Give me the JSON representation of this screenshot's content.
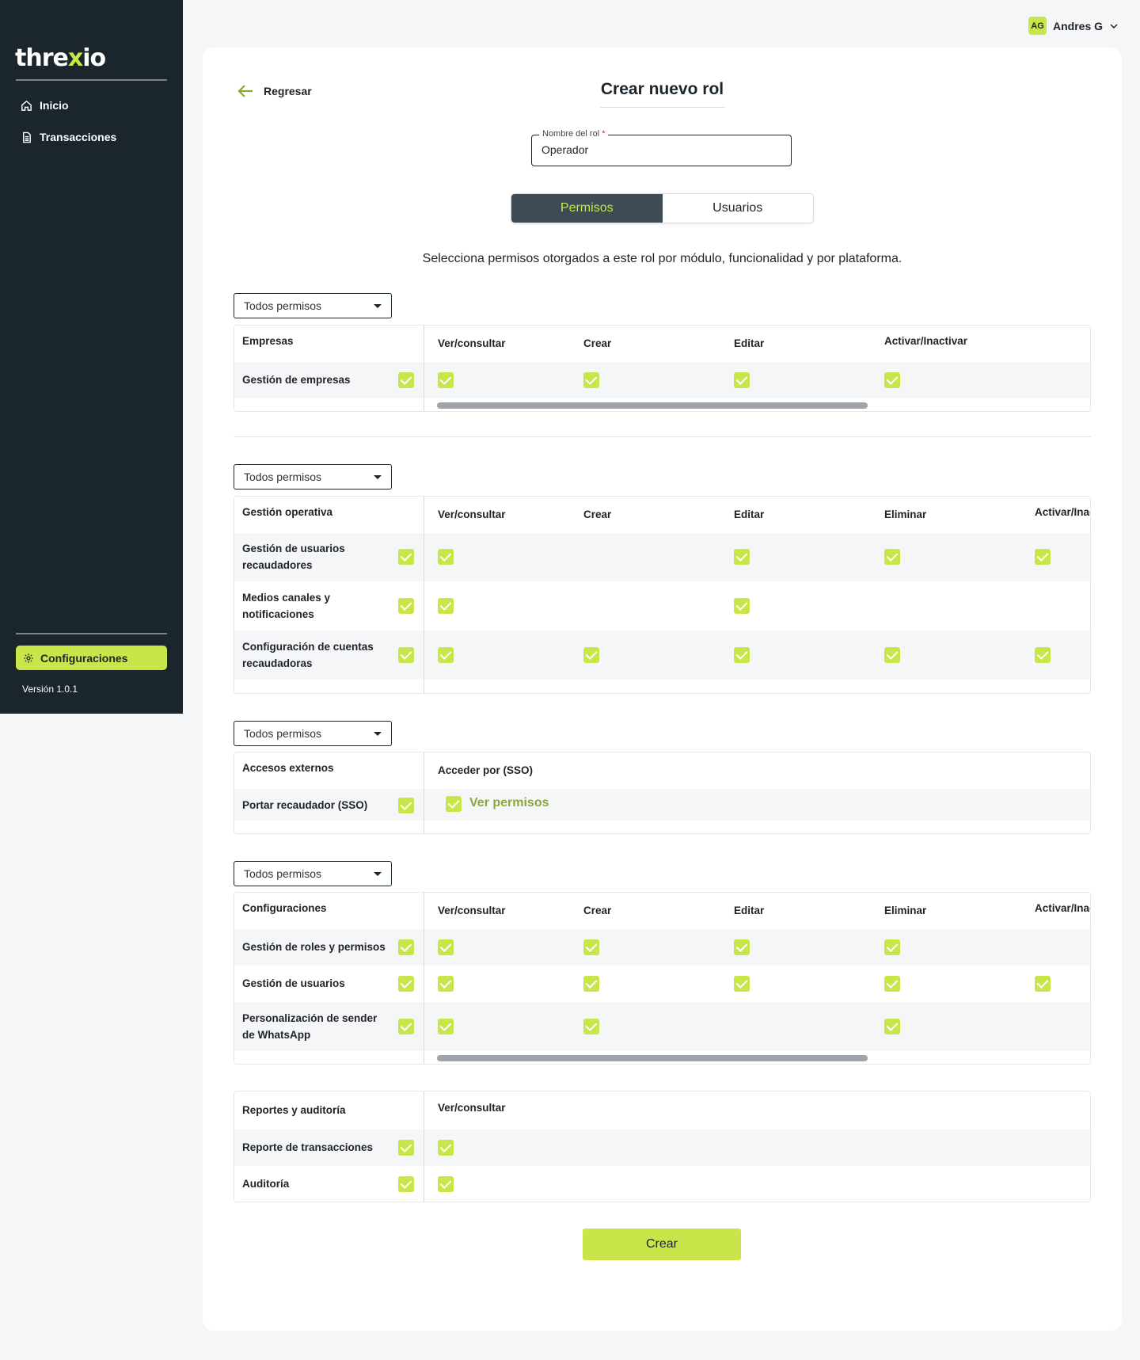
{
  "sidebar": {
    "logo_pre": "thre",
    "logo_x": "x",
    "logo_post": "io",
    "items": [
      {
        "label": "Inicio",
        "icon": "home-icon"
      },
      {
        "label": "Transacciones",
        "icon": "document-icon"
      }
    ],
    "config_label": "Configuraciones",
    "version": "Versión 1.0.1"
  },
  "user": {
    "initials": "AG",
    "name": "Andres G"
  },
  "page": {
    "back_label": "Regresar",
    "title": "Crear nuevo rol",
    "role_field": {
      "label": "Nombre del rol",
      "required_mark": "*",
      "value": "Operador"
    },
    "tabs": {
      "permisos": "Permisos",
      "usuarios": "Usuarios"
    },
    "description": "Selecciona permisos otorgados a este rol por módulo, funcionalidad y por plataforma.",
    "create_label": "Crear"
  },
  "sections": {
    "empresas": {
      "dropdown": "Todos permisos",
      "header": "Empresas",
      "columns": [
        "Ver/consultar",
        "Crear",
        "Editar",
        "Activar/Inactivar"
      ],
      "rows": [
        {
          "label": "Gestión de empresas"
        }
      ]
    },
    "operativa": {
      "dropdown": "Todos permisos",
      "header": "Gestión operativa",
      "columns": [
        "Ver/consultar",
        "Crear",
        "Editar",
        "Eliminar",
        "Activar/Inac"
      ],
      "rows": [
        {
          "label_1": "Gestión de usuarios",
          "label_2": "recaudadores"
        },
        {
          "label_1": "Medios canales y",
          "label_2": "notificaciones"
        },
        {
          "label_1": "Configuración de cuentas",
          "label_2": "recaudadoras"
        }
      ]
    },
    "externos": {
      "dropdown": "Todos permisos",
      "header": "Accesos externos",
      "column": "Acceder por (SSO)",
      "rows": [
        {
          "label": "Portar recaudador (SSO)",
          "link": "Ver permisos"
        }
      ]
    },
    "configuraciones": {
      "dropdown": "Todos permisos",
      "header": "Configuraciones",
      "columns": [
        "Ver/consultar",
        "Crear",
        "Editar",
        "Eliminar",
        "Activar/Inac"
      ],
      "rows": [
        {
          "label_1": "Gestión de roles y permisos"
        },
        {
          "label_1": "Gestión de usuarios"
        },
        {
          "label_1": "Personalización de sender",
          "label_2": "de WhatsApp"
        }
      ]
    },
    "reportes": {
      "header": "Reportes y auditoría",
      "column": "Ver/consultar",
      "rows": [
        {
          "label": "Reporte de transacciones"
        },
        {
          "label": "Auditoría"
        }
      ]
    }
  },
  "colors": {
    "accent": "#c8e64a",
    "sidebar": "#1a252c",
    "tab_active": "#3d4b55"
  }
}
